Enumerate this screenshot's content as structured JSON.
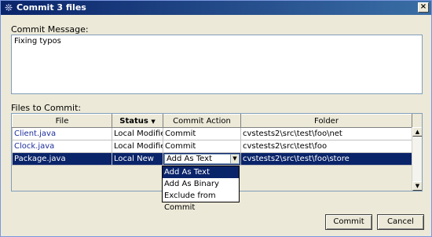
{
  "window": {
    "title": "Commit 3 files",
    "close": "×"
  },
  "commit_message": {
    "label": "Commit Message:",
    "value": "Fixing typos"
  },
  "files": {
    "label": "Files to Commit:",
    "columns": {
      "file": "File",
      "status": "Status",
      "action": "Commit Action",
      "folder": "Folder"
    },
    "status_sort_icon": "▼",
    "rows": [
      {
        "file": "Client.java",
        "status": "Local Modified",
        "action": "Commit",
        "folder": "cvstests2\\src\\test\\foo\\net"
      },
      {
        "file": "Clock.java",
        "status": "Local Modified",
        "action": "Commit",
        "folder": "cvstests2\\src\\test\\foo"
      },
      {
        "file": "Package.java",
        "status": "Local New",
        "action": "Add As Text",
        "folder": "cvstests2\\src\\test\\foo\\store"
      }
    ]
  },
  "dropdown_options": [
    "Add As Text",
    "Add As Binary",
    "Exclude from Commit"
  ],
  "buttons": {
    "commit": "Commit",
    "cancel": "Cancel"
  },
  "colors": {
    "title_bar": "#0a246a",
    "selection": "#0a246a",
    "file_link": "#1c2e9c"
  }
}
